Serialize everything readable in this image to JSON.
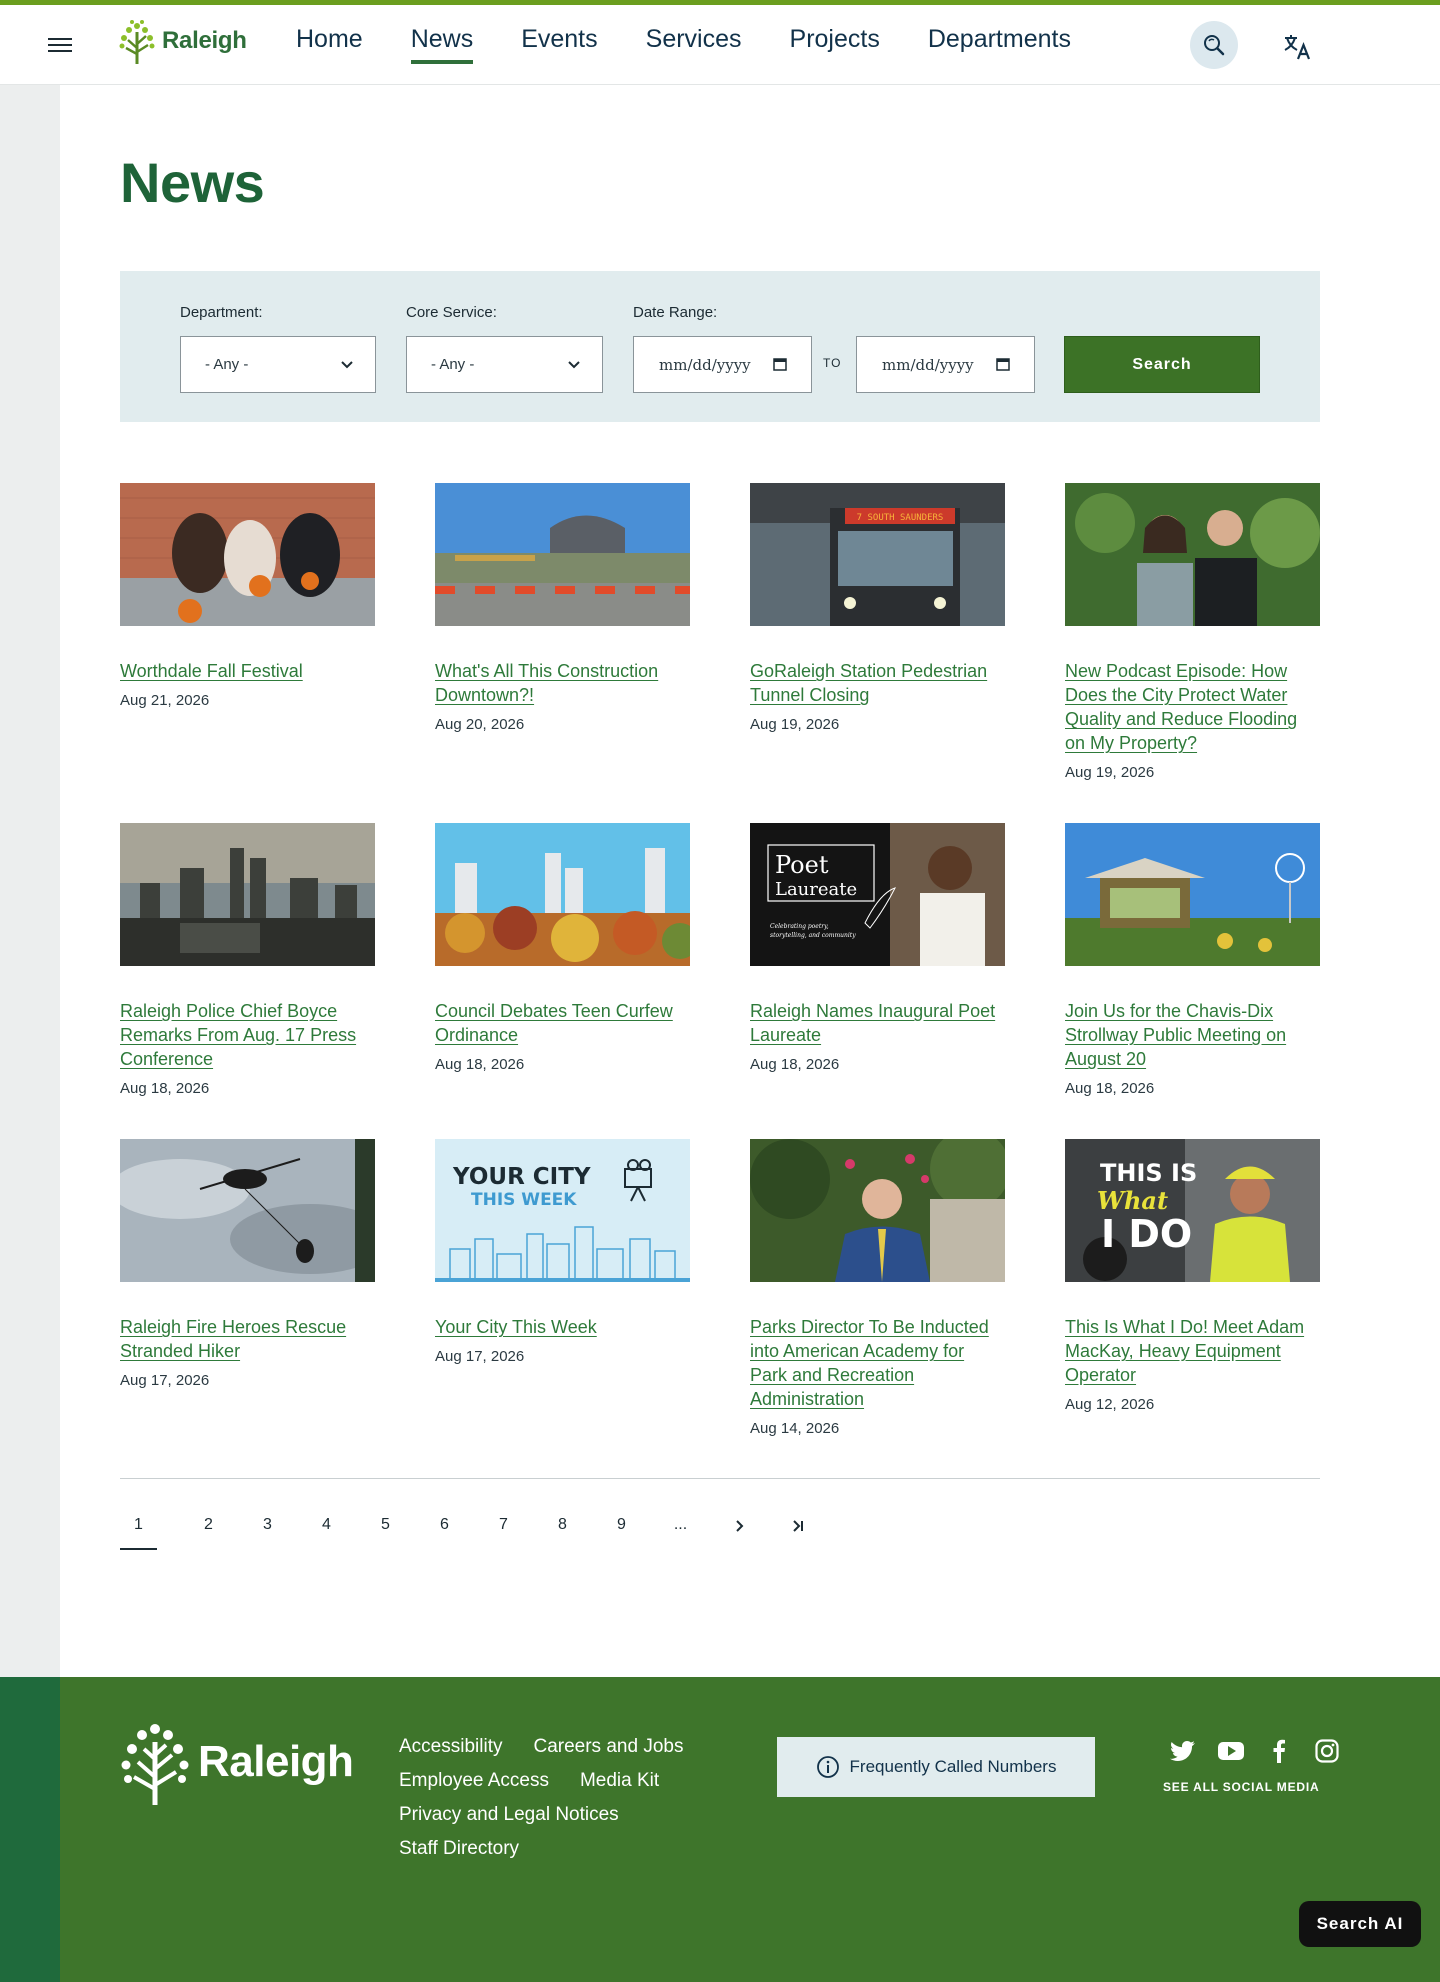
{
  "header": {
    "logo_text": "Raleigh",
    "nav": [
      "Home",
      "News",
      "Events",
      "Services",
      "Projects",
      "Departments"
    ],
    "active_nav": "News"
  },
  "page": {
    "title": "News"
  },
  "filters": {
    "department": {
      "label": "Department:",
      "value": "- Any -"
    },
    "core_service": {
      "label": "Core Service:",
      "value": "- Any -"
    },
    "date_range": {
      "label": "Date Range:",
      "from_placeholder": "mm/dd/yyyy",
      "to_placeholder": "mm/dd/yyyy",
      "to_label": "TO"
    },
    "search_label": "Search"
  },
  "articles": [
    {
      "title": "Worthdale Fall Festival",
      "date": "Aug 21, 2026"
    },
    {
      "title": "What's All This Construction Downtown?!",
      "date": "Aug 20, 2026"
    },
    {
      "title": "GoRaleigh Station Pedestrian Tunnel Closing",
      "date": "Aug 19, 2026"
    },
    {
      "title": "New Podcast Episode: How Does the City Protect Water Quality and Reduce Flooding on My Property?",
      "date": "Aug 19, 2026"
    },
    {
      "title": "Raleigh Police Chief Boyce Remarks From Aug. 17 Press Conference",
      "date": "Aug 18, 2026"
    },
    {
      "title": "Council Debates Teen Curfew Ordinance",
      "date": "Aug 18, 2026"
    },
    {
      "title": "Raleigh Names Inaugural Poet Laureate",
      "date": "Aug 18, 2026"
    },
    {
      "title": "Join Us for the Chavis-Dix Strollway Public Meeting on August 20",
      "date": "Aug 18, 2026"
    },
    {
      "title": "Raleigh Fire Heroes Rescue Stranded Hiker",
      "date": "Aug 17, 2026"
    },
    {
      "title": "Your City This Week",
      "date": "Aug 17, 2026"
    },
    {
      "title": "Parks Director To Be Inducted into American Academy for Park and Recreation Administration",
      "date": "Aug 14, 2026"
    },
    {
      "title": "This Is What I Do! Meet Adam MacKay, Heavy Equipment Operator",
      "date": "Aug 12, 2026"
    }
  ],
  "image_text": {
    "bus_sign": "7 SOUTH SAUNDERS",
    "poet_title_1": "Poet",
    "poet_title_2": "Laureate",
    "poet_tagline_1": "Celebrating poetry,",
    "poet_tagline_2": "storytelling, and community",
    "ycw_1": "YOUR CITY",
    "ycw_2": "THIS WEEK",
    "tiwid_1": "THIS IS",
    "tiwid_2": "What",
    "tiwid_3": "I DO"
  },
  "pagination": {
    "pages": [
      "1",
      "2",
      "3",
      "4",
      "5",
      "6",
      "7",
      "8",
      "9",
      "..."
    ],
    "current": "1"
  },
  "footer": {
    "logo_text": "Raleigh",
    "links_row1": [
      "Accessibility",
      "Careers and Jobs"
    ],
    "links_row2": [
      "Employee Access",
      "Media Kit"
    ],
    "links_row3": [
      "Privacy and Legal Notices"
    ],
    "links_row4": [
      "Staff Directory"
    ],
    "frequently_called": "Frequently Called Numbers",
    "see_all_social": "SEE ALL SOCIAL MEDIA",
    "social_icons": [
      "twitter-icon",
      "youtube-icon",
      "facebook-icon",
      "instagram-icon"
    ]
  },
  "search_ai_label": "Search AI",
  "colors": {
    "brand_green": "#1e6338",
    "link_green": "#2e7a3a",
    "button_green": "#3c7226",
    "footer_green": "#3e752b",
    "filter_bg": "#e1ecee",
    "accent_bar": "#6b9e1f"
  }
}
